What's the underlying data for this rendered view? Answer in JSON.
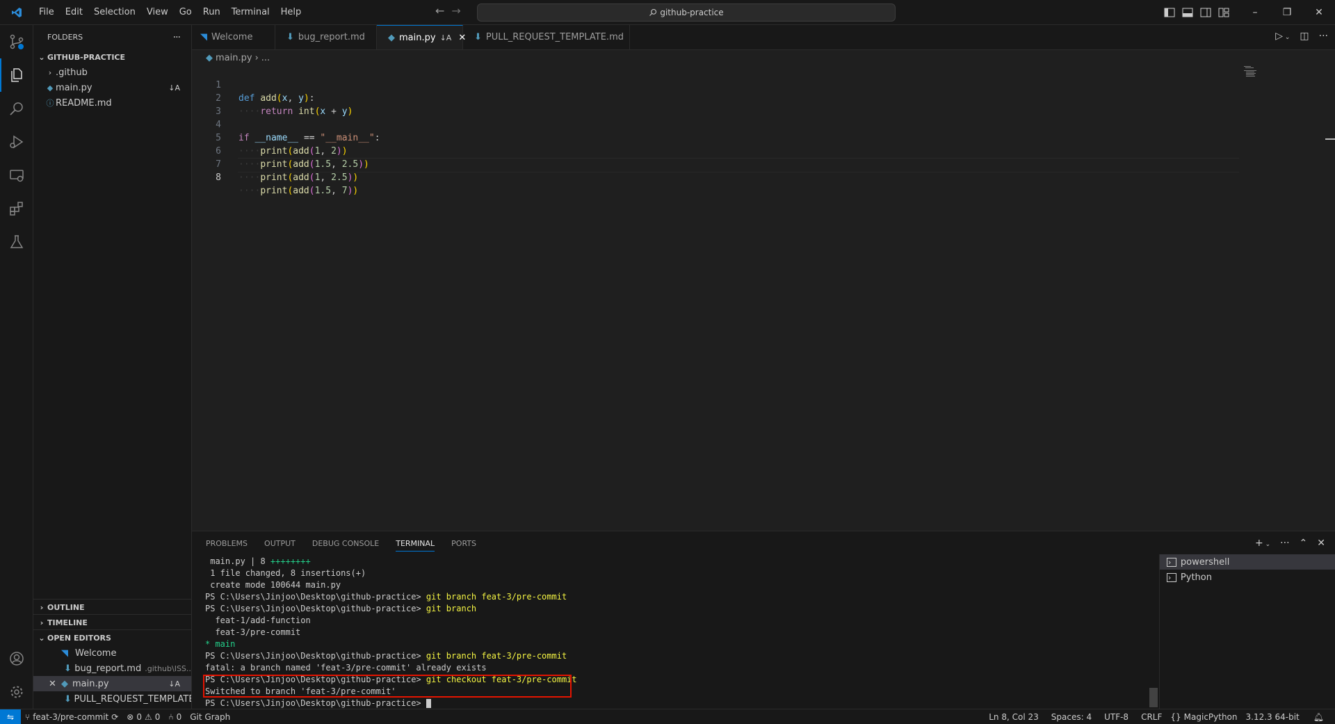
{
  "titlebar": {
    "menu": [
      "File",
      "Edit",
      "Selection",
      "View",
      "Go",
      "Run",
      "Terminal",
      "Help"
    ],
    "search_text": "github-practice",
    "window_buttons": {
      "minimize": "–",
      "restore": "❐",
      "close": "✕"
    }
  },
  "sidebar": {
    "folders_title": "FOLDERS",
    "more": "···",
    "root": "GITHUB-PRACTICE",
    "items": [
      {
        "label": ".github",
        "type": "folder",
        "badge": ""
      },
      {
        "label": "main.py",
        "type": "python",
        "badge": "↓A"
      },
      {
        "label": "README.md",
        "type": "info",
        "badge": ""
      }
    ],
    "outline": "OUTLINE",
    "timeline": "TIMELINE",
    "open_editors": "OPEN EDITORS",
    "open_editor_items": [
      {
        "label": "Welcome",
        "desc": "",
        "badge": ""
      },
      {
        "label": "bug_report.md",
        "desc": ".github\\ISS...",
        "badge": ""
      },
      {
        "label": "main.py",
        "desc": "",
        "badge": "↓A"
      },
      {
        "label": "PULL_REQUEST_TEMPLATE...",
        "desc": "",
        "badge": ""
      }
    ]
  },
  "tabs": [
    {
      "label": "Welcome",
      "badge": ""
    },
    {
      "label": "bug_report.md",
      "badge": ""
    },
    {
      "label": "main.py",
      "badge": "↓A"
    },
    {
      "label": "PULL_REQUEST_TEMPLATE.md",
      "badge": ""
    }
  ],
  "breadcrumb": {
    "file": "main.py",
    "sep": "›",
    "more": "..."
  },
  "code": {
    "line_numbers": [
      "1",
      "2",
      "3",
      "4",
      "5",
      "6",
      "7",
      "8"
    ],
    "kw_def": "def",
    "fn_add": "add",
    "var_x": "x",
    "var_y": "y",
    "kw_return": "return",
    "fn_int": "int",
    "kw_if": "if",
    "dunder_name": "__name__",
    "eq": "==",
    "str_main": "\"__main__\"",
    "fn_print": "print",
    "n1": "1",
    "n2": "2",
    "n15": "1.5",
    "n25": "2.5",
    "n7": "7"
  },
  "panel": {
    "tabs": [
      "PROBLEMS",
      "OUTPUT",
      "DEBUG CONSOLE",
      "TERMINAL",
      "PORTS"
    ],
    "terminal_lines": {
      "l1a": " main.py | 8 ",
      "l1b": "++++++++",
      "l2": " 1 file changed, 8 insertions(+)",
      "l3": " create mode 100644 main.py",
      "prompt": "PS C:\\Users\\Jinjoo\\Desktop\\github-practice> ",
      "cmd_branch_create": "git branch feat-3/pre-commit",
      "cmd_branch": "git branch",
      "b1": "  feat-1/add-function",
      "b2": "  feat-3/pre-commit",
      "b3": "* main",
      "fatal": "fatal: a branch named 'feat-3/pre-commit' already exists",
      "cmd_checkout": "git checkout feat-3/pre-commit",
      "switched": "Switched to branch 'feat-3/pre-commit'"
    },
    "terminals": [
      "powershell",
      "Python"
    ]
  },
  "statusbar": {
    "branch": "feat-3/pre-commit",
    "errors": "0",
    "warnings": "0",
    "ports": "0",
    "git_graph": "Git Graph",
    "position": "Ln 8, Col 23",
    "spaces": "Spaces: 4",
    "encoding": "UTF-8",
    "eol": "CRLF",
    "language": "MagicPython",
    "interpreter": "3.12.3 64-bit"
  }
}
